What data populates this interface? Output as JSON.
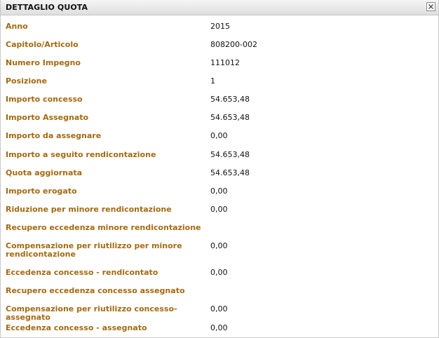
{
  "dialog": {
    "title": "DETTAGLIO QUOTA",
    "close_icon": "close-icon"
  },
  "rows": [
    {
      "label": "Anno",
      "value": "2015"
    },
    {
      "label": "Capitolo/Articolo",
      "value": "808200-002"
    },
    {
      "label": "Numero Impegno",
      "value": "111012"
    },
    {
      "label": "Posizione",
      "value": "1"
    },
    {
      "label": "Importo concesso",
      "value": "54.653,48"
    },
    {
      "label": "Importo Assegnato",
      "value": "54.653,48"
    },
    {
      "label": "Importo da assegnare",
      "value": "0,00"
    },
    {
      "label": "Importo a seguito rendicontazione",
      "value": "54.653,48"
    },
    {
      "label": "Quota aggiornata",
      "value": "54.653,48"
    },
    {
      "label": "Importo erogato",
      "value": "0,00"
    },
    {
      "label": "Riduzione per minore rendicontazione",
      "value": "0,00"
    },
    {
      "label": "Recupero eccedenza minore rendicontazione",
      "value": ""
    },
    {
      "label": "Compensazione per riutilizzo per minore rendicontazione",
      "value": "0,00"
    },
    {
      "label": "Eccedenza concesso - rendicontato",
      "value": "0,00"
    },
    {
      "label": "Recupero eccedenza concesso assegnato",
      "value": ""
    },
    {
      "label": "Compensazione per riutilizzo concesso-assegnato",
      "value": "0,00"
    },
    {
      "label": "Eccedenza concesso - assegnato",
      "value": "0,00"
    }
  ]
}
